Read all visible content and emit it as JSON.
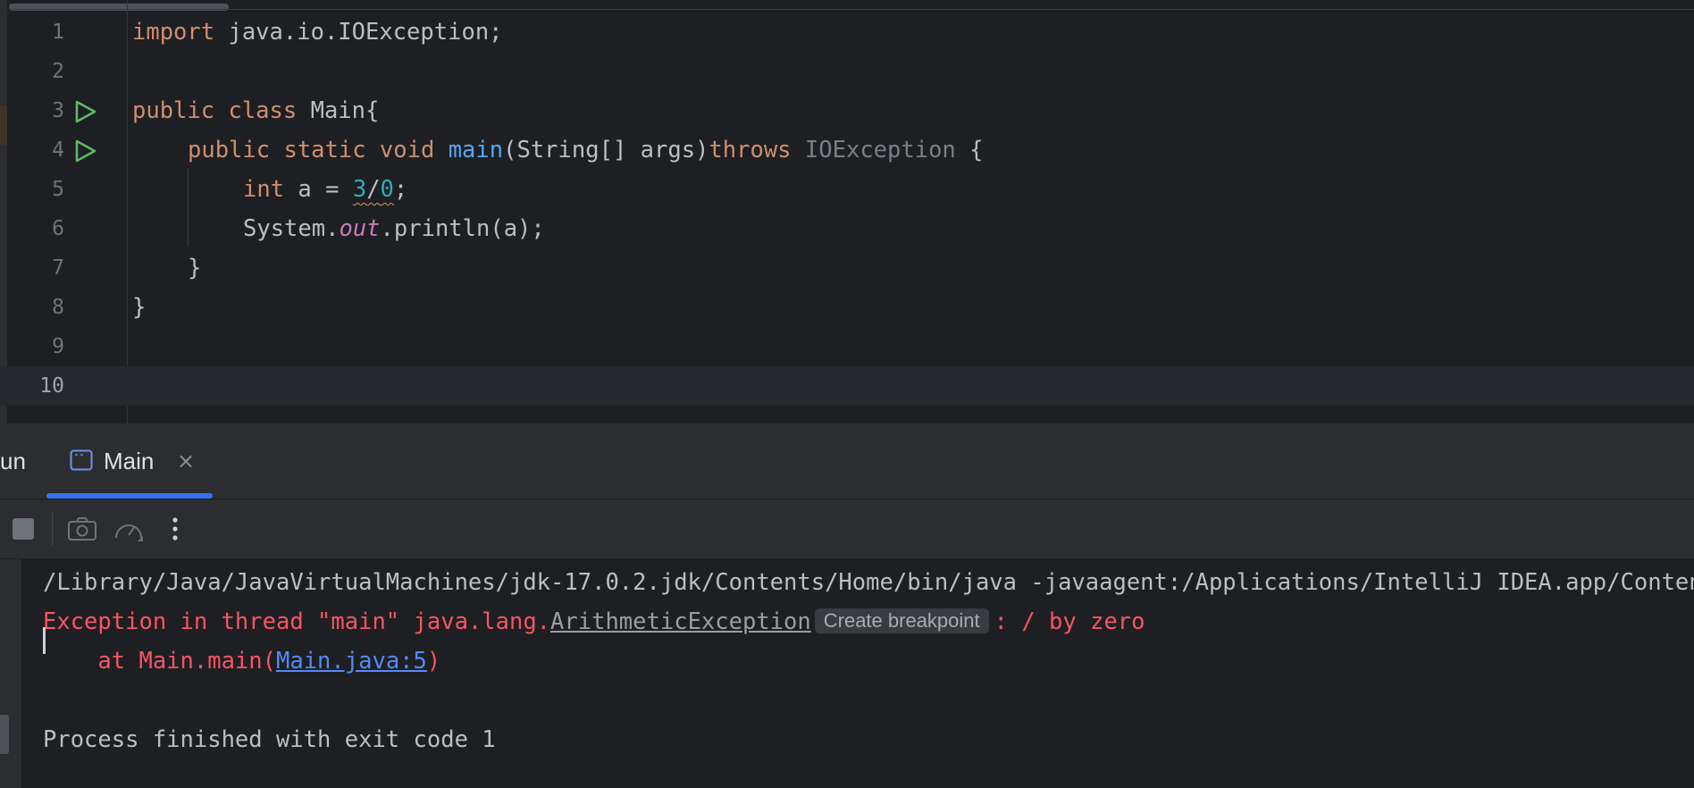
{
  "editor": {
    "lines": [
      {
        "number": "1"
      },
      {
        "number": "2"
      },
      {
        "number": "3"
      },
      {
        "number": "4"
      },
      {
        "number": "5"
      },
      {
        "number": "6"
      },
      {
        "number": "7"
      },
      {
        "number": "8"
      },
      {
        "number": "9"
      },
      {
        "number": "10"
      }
    ],
    "code": {
      "l1_kw": "import",
      "l1_rest": " java.io.IOException;",
      "l3_kw": "public class",
      "l3_rest": " Main{",
      "l4_kw1": "public static void",
      "l4_fn": "main",
      "l4_mid": "(String[] args)",
      "l4_kw2": "throws",
      "l4_exc": "IOException",
      "l4_end": " {",
      "l5_kw": "int",
      "l5_mid": " a = ",
      "l5_num1": "3",
      "l5_slash": "/",
      "l5_num2": "0",
      "l5_end": ";",
      "l6_pre": "System.",
      "l6_static": "out",
      "l6_post": ".println(a);",
      "l7": "}",
      "l8": "}"
    }
  },
  "run_panel": {
    "label": "un",
    "tab": {
      "label": "Main",
      "close": "×"
    }
  },
  "console": {
    "command": "/Library/Java/JavaVirtualMachines/jdk-17.0.2.jdk/Contents/Home/bin/java -javaagent:/Applications/IntelliJ IDEA.app/Contents",
    "exception_prefix": "Exception in thread \"main\" java.lang.",
    "exception_class": "ArithmeticException",
    "breakpoint_hint": "Create breakpoint",
    "exception_suffix": ": / by zero",
    "stack_prefix": "    at Main.main(",
    "stack_link": "Main.java:5",
    "stack_suffix": ")",
    "exit": "Process finished with exit code 1"
  },
  "colors": {
    "keyword": "#cf8e6d",
    "function": "#56a8f5",
    "static_field": "#c77dbb",
    "number": "#2aacb8",
    "error_text": "#f75464",
    "link": "#548af7",
    "accent": "#3574f0",
    "run_icon": "#5fb865"
  },
  "icons": [
    "run-line-icon",
    "run-method-icon",
    "console-tab-icon",
    "close-icon",
    "stop-icon",
    "camera-icon",
    "profiler-icon",
    "more-icon"
  ]
}
